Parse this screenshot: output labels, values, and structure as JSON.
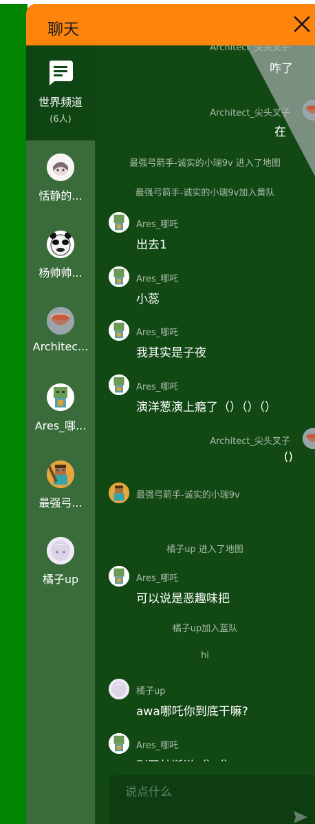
{
  "header": {
    "title": "聊天"
  },
  "channel": {
    "name": "世界频道",
    "count": "(6人)"
  },
  "users": [
    {
      "name": "恬静的...",
      "avatar": "anime-girl"
    },
    {
      "name": "杨帅帅...",
      "avatar": "panda-meme"
    },
    {
      "name": "Architec...",
      "avatar": "bowl"
    },
    {
      "name": "Ares_哪...",
      "avatar": "zombie"
    },
    {
      "name": "最强弓...",
      "avatar": "steve"
    },
    {
      "name": "橘子up",
      "avatar": "white-hair-girl"
    }
  ],
  "messages": [
    {
      "kind": "mine",
      "sender": "Architect_尖头叉子",
      "text": "咋了"
    },
    {
      "kind": "mine",
      "sender": "Architect_尖头叉子",
      "text": "在"
    },
    {
      "kind": "sys",
      "text": "最强弓箭手-诚实的小瑞9v 进入了地图"
    },
    {
      "kind": "sys",
      "text": "最强弓箭手-诚实的小瑞9v加入黄队"
    },
    {
      "kind": "other",
      "sender": "Ares_哪吒",
      "text": "出去1"
    },
    {
      "kind": "other",
      "sender": "Ares_哪吒",
      "text": "小蕊"
    },
    {
      "kind": "other",
      "sender": "Ares_哪吒",
      "text": "我其实是子夜"
    },
    {
      "kind": "other",
      "sender": "Ares_哪吒",
      "text": "演洋葱演上瘾了（）（）（）"
    },
    {
      "kind": "mine",
      "sender": "Architect_尖头叉子",
      "text": "()"
    },
    {
      "kind": "other",
      "sender": "最强弓箭手-诚实的小瑞9v",
      "text": ""
    },
    {
      "kind": "sys",
      "text": "橘子up 进入了地图"
    },
    {
      "kind": "other",
      "sender": "Ares_哪吒",
      "text": "可以说是恶趣味把"
    },
    {
      "kind": "sys",
      "text": "橘子up加入蓝队"
    },
    {
      "kind": "sys",
      "text": "hi"
    },
    {
      "kind": "other",
      "sender": "橘子up",
      "text": "awa哪吒你到底干嘛?"
    },
    {
      "kind": "other",
      "sender": "Ares_哪吒",
      "text": "别跟林斯说（）（）"
    }
  ],
  "input": {
    "placeholder": "说点什么"
  },
  "colors": {
    "header": "#fd850d",
    "sidebar": "#3a6b3b",
    "chat_bg": "#114814",
    "outer": "#018401"
  }
}
